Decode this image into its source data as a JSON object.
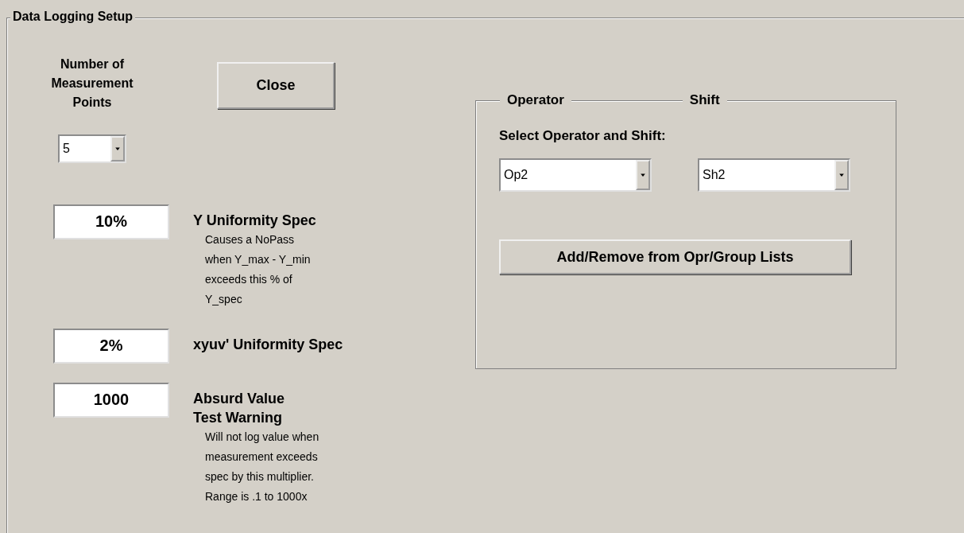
{
  "group": {
    "title": "Data Logging Setup"
  },
  "points": {
    "label_lines": [
      "Number of",
      "Measurement",
      "Points"
    ],
    "value": "5"
  },
  "close_button": "Close",
  "specs": [
    {
      "value": "10%",
      "label_lines": [
        "Y Uniformity Spec"
      ],
      "description_lines": [
        "Causes a NoPass",
        "when Y_max - Y_min",
        "exceeds this % of",
        "Y_spec"
      ]
    },
    {
      "value": "2%",
      "label_lines": [
        "xyuv' Uniformity Spec"
      ]
    },
    {
      "value": "1000",
      "label_lines": [
        "Absurd Value",
        "Test Warning"
      ],
      "description_lines": [
        "Will not log value when",
        "measurement exceeds",
        "spec by this multiplier.",
        "Range is .1 to 1000x"
      ]
    }
  ],
  "operator_shift": {
    "legend": [
      "Operator",
      "Shift"
    ],
    "prompt": "Select Operator and Shift:",
    "operator": "Op2",
    "shift": "Sh2",
    "button": "Add/Remove from Opr/Group Lists"
  }
}
